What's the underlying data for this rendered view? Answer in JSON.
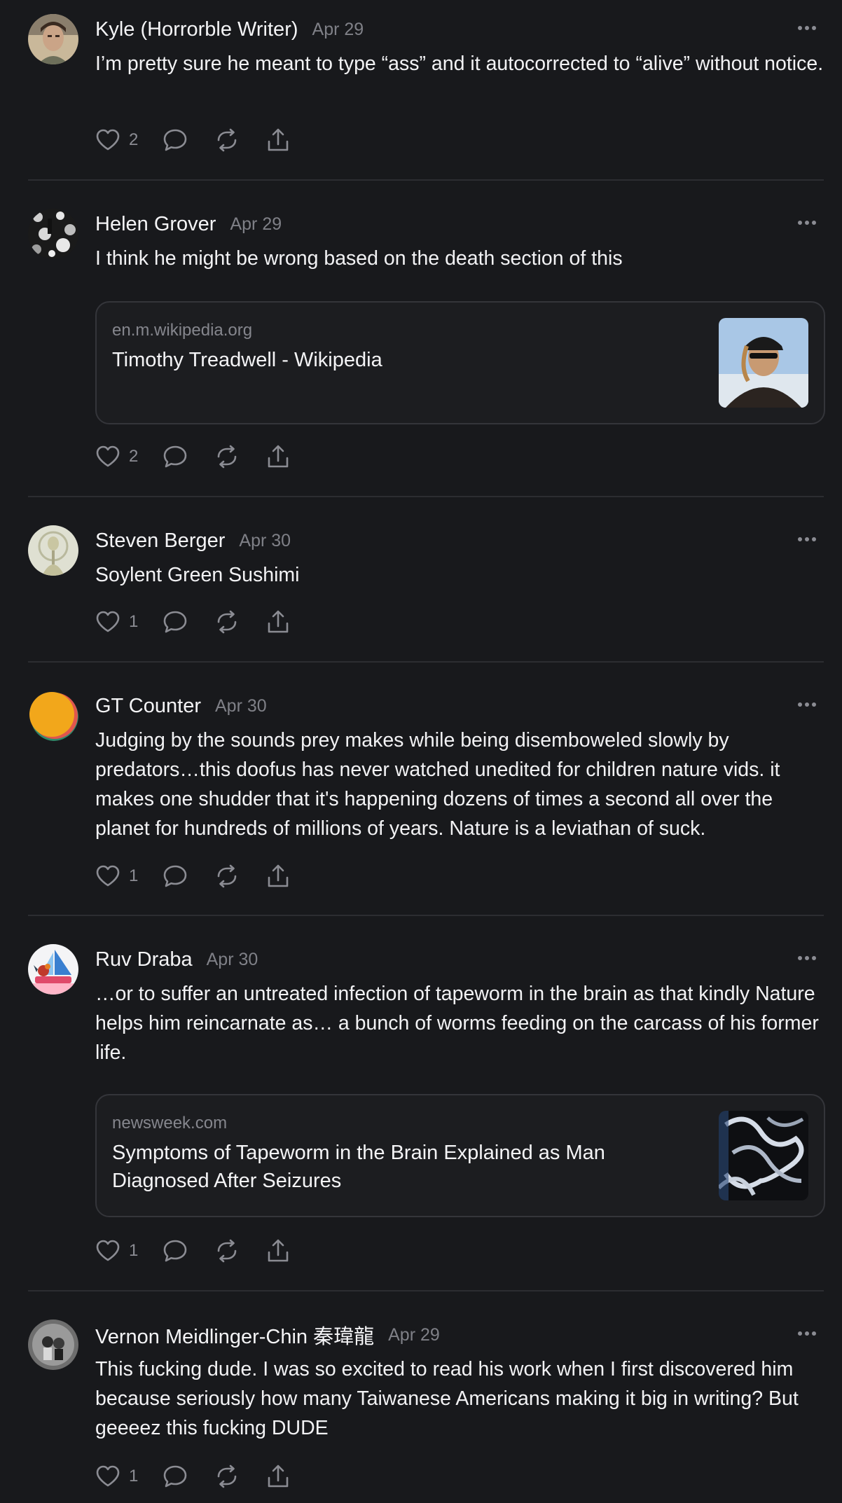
{
  "posts": [
    {
      "author": "Kyle (Horrorble Writer)",
      "date": "Apr 29",
      "text": "I’m pretty sure he meant to type “ass” and it autocorrected to “alive” without notice.",
      "likes": "2",
      "avatar_icon": "person-portrait-icon"
    },
    {
      "author": "Helen Grover",
      "date": "Apr 29",
      "text": "I think he might be wrong based on the death section of this",
      "likes": "2",
      "avatar_icon": "bw-texture-avatar-icon",
      "link": {
        "domain": "en.m.wikipedia.org",
        "title": "Timothy Treadwell - Wikipedia"
      }
    },
    {
      "author": "Steven Berger",
      "date": "Apr 30",
      "text": "Soylent Green Sushimi",
      "likes": "1",
      "avatar_icon": "pale-figure-avatar-icon"
    },
    {
      "author": "GT Counter",
      "date": "Apr 30",
      "text": "Judging by the sounds prey makes while being disemboweled slowly by predators…this doofus has never watched unedited for children nature vids. it makes one shudder that it's happening dozens of times a second all over the planet for hundreds of millions of years. Nature is a leviathan of suck.",
      "likes": "1",
      "avatar_icon": "orange-circle-avatar-icon"
    },
    {
      "author": "Ruv Draba",
      "date": "Apr 30",
      "text": "…or to suffer an untreated infection of tapeworm in the brain as that kindly Nature helps him reincarnate as… a bunch of worms feeding on the carcass of his former life.",
      "likes": "1",
      "avatar_icon": "rooster-boat-avatar-icon",
      "link": {
        "domain": "newsweek.com",
        "title": "Symptoms of Tapeworm in the Brain Explained as Man Diagnosed After Seizures"
      }
    },
    {
      "author": "Vernon Meidlinger-Chin 秦瑋龍",
      "date": "Apr 29",
      "text": "This fucking dude. I was so excited to read his work when I first discovered him because seriously how many Taiwanese Americans making it big in writing? But geeeez this fucking DUDE",
      "likes": "1",
      "avatar_icon": "couple-photo-avatar-icon"
    }
  ],
  "icons": {
    "like": "heart-icon",
    "reply": "comment-bubble-icon",
    "repost": "repost-arrows-icon",
    "share": "share-upload-icon",
    "more": "more-horizontal-icon"
  },
  "colors": {
    "background": "#18191c",
    "divider": "#2c2d31",
    "text_primary": "#f2f2f4",
    "text_muted": "#7f8087"
  }
}
